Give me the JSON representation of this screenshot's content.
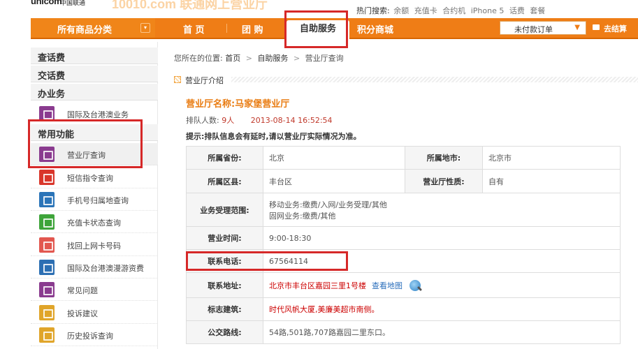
{
  "top": {
    "logo_en": "unicom",
    "logo_cn": "中国联通",
    "brand_text": "10010.com 联通网上营业厅",
    "hot_label": "热门搜索:",
    "hot_words": [
      "余额",
      "充值卡",
      "合约机",
      "iPhone 5",
      "话费",
      "套餐"
    ]
  },
  "nav": {
    "all_categories": "所有商品分类",
    "all_arrow": "▾",
    "items": [
      "首 页",
      "团 购",
      "自助服务",
      "积分商城"
    ],
    "active_index": 2,
    "order_select": "未付款订单",
    "order_arrow": "▼",
    "cart": "去结算"
  },
  "sidebar": {
    "sections": [
      "查话费",
      "交话费",
      "办业务",
      "常用功能"
    ],
    "biz_item": "国际及台港澳业务",
    "items": [
      {
        "label": "营业厅查询",
        "icon": "house-icon",
        "color": "#8a3b8f"
      },
      {
        "label": "短信指令查询",
        "icon": "message-icon",
        "color": "#d9362b"
      },
      {
        "label": "手机号归属地查询",
        "icon": "phone-search-icon",
        "color": "#2a74b8"
      },
      {
        "label": "充值卡状态查询",
        "icon": "card-icon",
        "color": "#3ea43a"
      },
      {
        "label": "找回上网卡号码",
        "icon": "netcard-icon",
        "color": "#e2574f"
      },
      {
        "label": "国际及台港澳漫游资费",
        "icon": "globe-icon",
        "color": "#2c6fb3"
      },
      {
        "label": "常见问题",
        "icon": "question-icon",
        "color": "#8a3b8f"
      },
      {
        "label": "投诉建议",
        "icon": "complaint-icon",
        "color": "#e0a52a"
      },
      {
        "label": "历史投诉查询",
        "icon": "history-icon",
        "color": "#e0a52a"
      }
    ],
    "biz_item_color": "#8a3b8f"
  },
  "breadcrumb": {
    "prefix": "您所在的位置:",
    "items": [
      "首页",
      "自助服务",
      "营业厅查询"
    ],
    "sep": ">"
  },
  "section_title": "营业厅介绍",
  "hall": {
    "name": "营业厅名称:马家堡营业厅",
    "queue_label": "排队人数:",
    "queue_value": "9人",
    "timestamp": "2013-08-14 16:52:54",
    "tip": "提示:排队信息会有延时,请以营业厅实际情况为准。"
  },
  "table": {
    "province_label": "所属省份:",
    "province": "北京",
    "city_label": "所属地市:",
    "city": "北京市",
    "district_label": "所属区县:",
    "district": "丰台区",
    "nature_label": "营业厅性质:",
    "nature": "自有",
    "scope_label": "业务受理范围:",
    "scope_line1": "移动业务:缴费/入网/业务受理/其他",
    "scope_line2": "固网业务:缴费/其他",
    "hours_label": "营业时间:",
    "hours": "9:00-18:30",
    "phone_label": "联系电话:",
    "phone": "67564114",
    "address_label": "联系地址:",
    "address": "北京市丰台区嘉园三里1号楼",
    "map_link": "查看地图",
    "landmark_label": "标志建筑:",
    "landmark": "时代风帆大厦,美廉美超市南侧。",
    "bus_label": "公交路线:",
    "bus": "54路,501路,707路嘉园二里东口。"
  },
  "annotation_color": "#d62828"
}
